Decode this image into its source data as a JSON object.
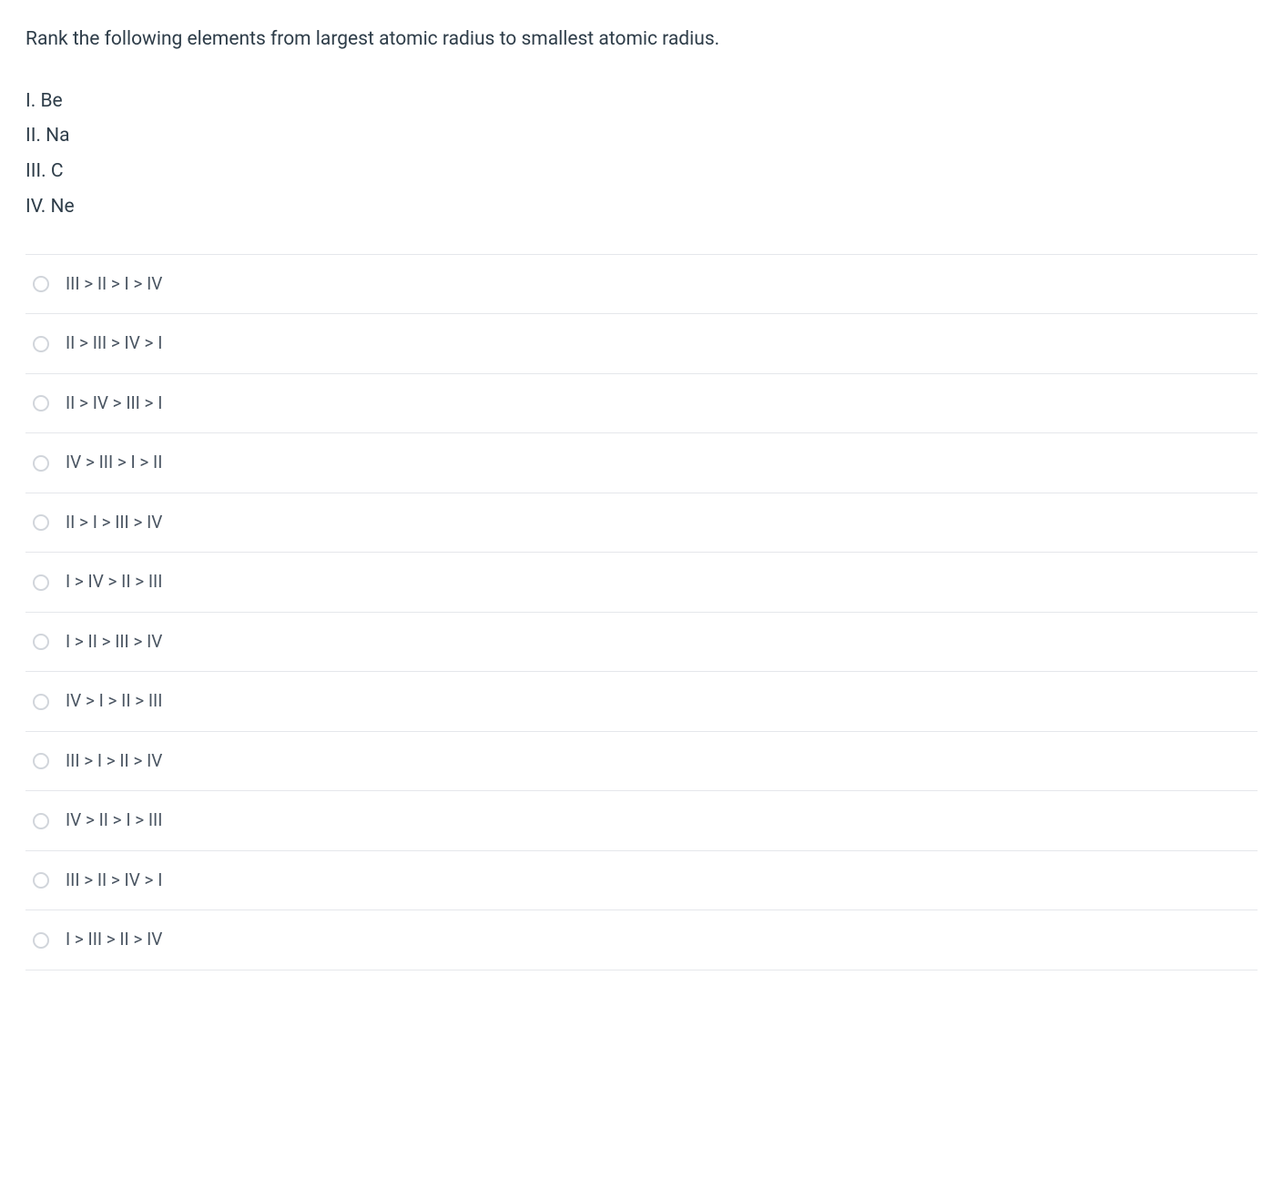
{
  "question": {
    "prompt": "Rank the following elements from largest atomic radius to smallest atomic radius.",
    "items": [
      "I. Be",
      "II. Na",
      "III. C",
      "IV. Ne"
    ]
  },
  "options": [
    "III > II > I > IV",
    "II > III > IV > I",
    "II > IV > III > I",
    "IV > III > I > II",
    "II > I > III > IV",
    "I > IV > II > III",
    "I > II > III > IV",
    "IV > I > II > III",
    "III > I > II > IV",
    "IV > II > I > III",
    "III > II > IV > I",
    "I > III > II > IV"
  ]
}
